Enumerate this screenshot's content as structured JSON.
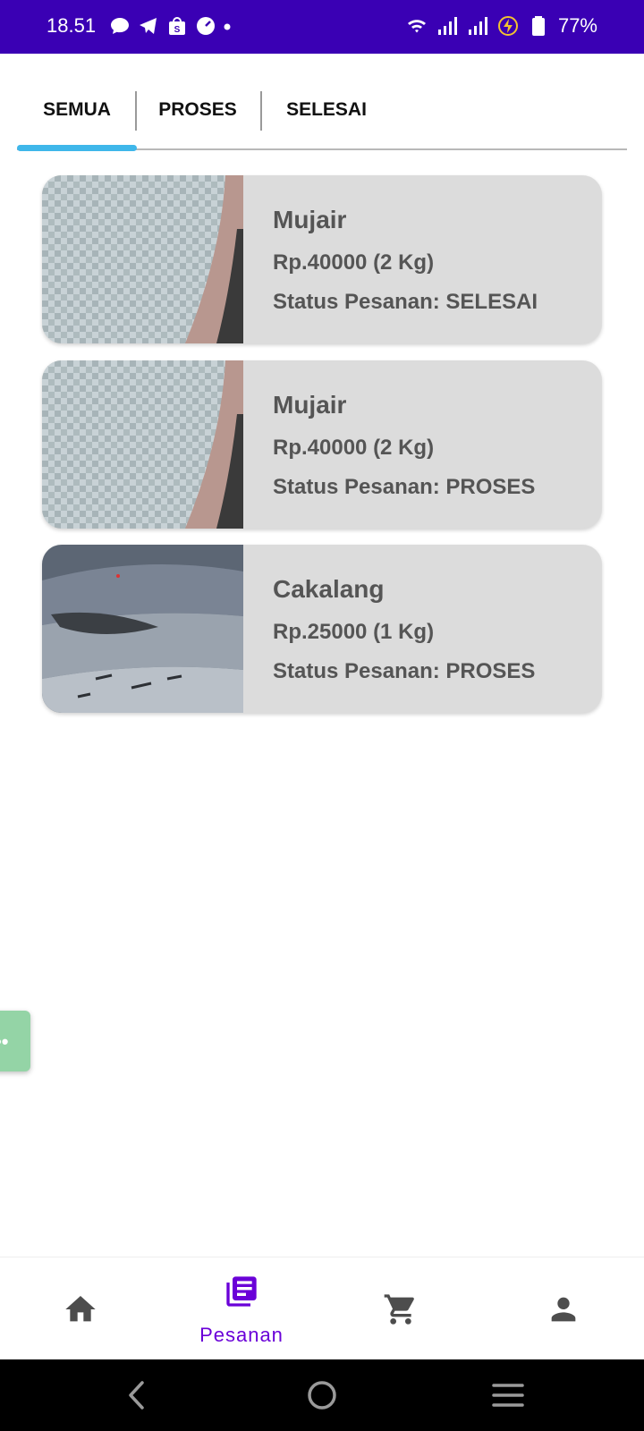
{
  "status_bar": {
    "time": "18.51",
    "battery": "77%",
    "left_icons": [
      "chat-bubble-icon",
      "telegram-icon",
      "shopee-icon",
      "speedometer-icon",
      "dot-icon"
    ],
    "right_icons": [
      "wifi-icon",
      "signal-icon",
      "signal-icon",
      "charging-icon",
      "battery-icon"
    ]
  },
  "tabs": [
    {
      "label": "SEMUA",
      "active": true
    },
    {
      "label": "PROSES",
      "active": false
    },
    {
      "label": "SELESAI",
      "active": false
    }
  ],
  "orders": [
    {
      "name": "Mujair",
      "price": "Rp.40000 (2 Kg)",
      "status": "Status Pesanan: SELESAI",
      "image": "fish-scales-photo"
    },
    {
      "name": "Mujair",
      "price": "Rp.40000 (2 Kg)",
      "status": "Status Pesanan: PROSES",
      "image": "fish-scales-photo"
    },
    {
      "name": "Cakalang",
      "price": "Rp.25000 (1 Kg)",
      "status": "Status Pesanan: PROSES",
      "image": "skipjack-fish-photo"
    }
  ],
  "floating": {
    "dots": "••"
  },
  "bottom_nav": [
    {
      "icon": "home-icon",
      "label": "",
      "active": false
    },
    {
      "icon": "orders-list-icon",
      "label": "Pesanan",
      "active": true
    },
    {
      "icon": "cart-icon",
      "label": "",
      "active": false
    },
    {
      "icon": "person-icon",
      "label": "",
      "active": false
    }
  ],
  "system_nav": [
    "back-icon",
    "home-circle-icon",
    "menu-icon"
  ],
  "colors": {
    "status_bar": "#3a00b4",
    "tab_indicator": "#3fb7ea",
    "card_bg": "#dcdcdc",
    "nav_active": "#6a00d8",
    "nav_inactive": "#4d4d4d"
  }
}
